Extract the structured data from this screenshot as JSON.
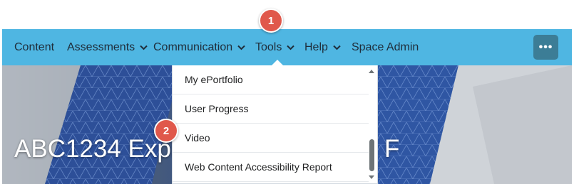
{
  "nav": {
    "items": [
      {
        "label": "Content",
        "has_dropdown": false
      },
      {
        "label": "Assessments",
        "has_dropdown": true
      },
      {
        "label": "Communication",
        "has_dropdown": true
      },
      {
        "label": "Tools",
        "has_dropdown": true
      },
      {
        "label": "Help",
        "has_dropdown": true
      },
      {
        "label": "Space Admin",
        "has_dropdown": false
      }
    ],
    "more_label": "•••"
  },
  "course": {
    "title": "ABC1234 Explo",
    "title_tail": "F"
  },
  "tools_menu": {
    "items": [
      "My ePortfolio",
      "User Progress",
      "Video",
      "Web Content Accessibility Report"
    ]
  },
  "callouts": [
    "1",
    "2"
  ],
  "colors": {
    "navbar": "#4fb6e2",
    "more_button": "#3c7d96",
    "badge": "#e0584b"
  }
}
